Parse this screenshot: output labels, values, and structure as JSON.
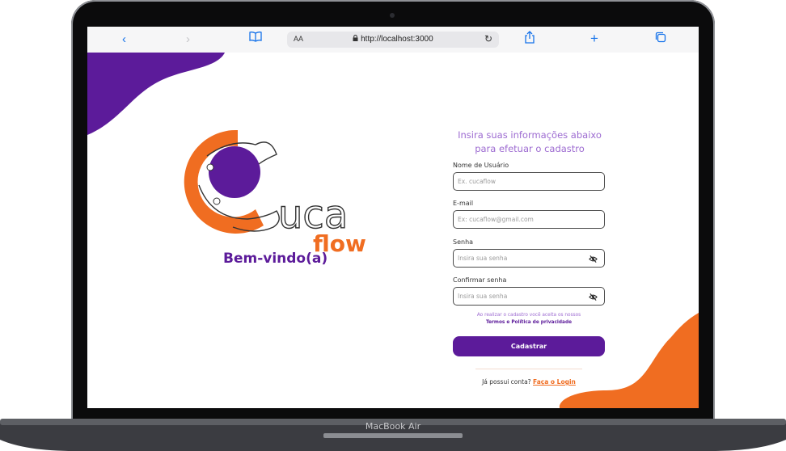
{
  "device": {
    "label": "MacBook Air"
  },
  "browser": {
    "text_size_label": "AA",
    "url": "http://localhost:3000"
  },
  "logo": {
    "word1": "uca",
    "word2": "flow",
    "welcome": "Bem-vindo(a)"
  },
  "form": {
    "title_line1": "Insira suas informações abaixo",
    "title_line2": "para efetuar o cadastro",
    "fields": [
      {
        "label": "Nome de Usuário",
        "placeholder": "Ex. cucaflow",
        "value": ""
      },
      {
        "label": "E-mail",
        "placeholder": "Ex: cucaflow@gmail.com",
        "value": ""
      },
      {
        "label": "Senha",
        "placeholder": "Insira sua senha",
        "value": ""
      },
      {
        "label": "Confirmar senha",
        "placeholder": "Insira sua senha",
        "value": ""
      }
    ],
    "terms_text": "Ao realizar o cadastro você aceita os nossos",
    "terms_link": "Termos e Política de privacidade",
    "submit_label": "Cadastrar",
    "login_prompt": "Já possui conta?",
    "login_link": "Faça o Login"
  },
  "colors": {
    "purple": "#5c1b9a",
    "orange": "#f06d21",
    "accent_light": "#9d6bd1"
  }
}
